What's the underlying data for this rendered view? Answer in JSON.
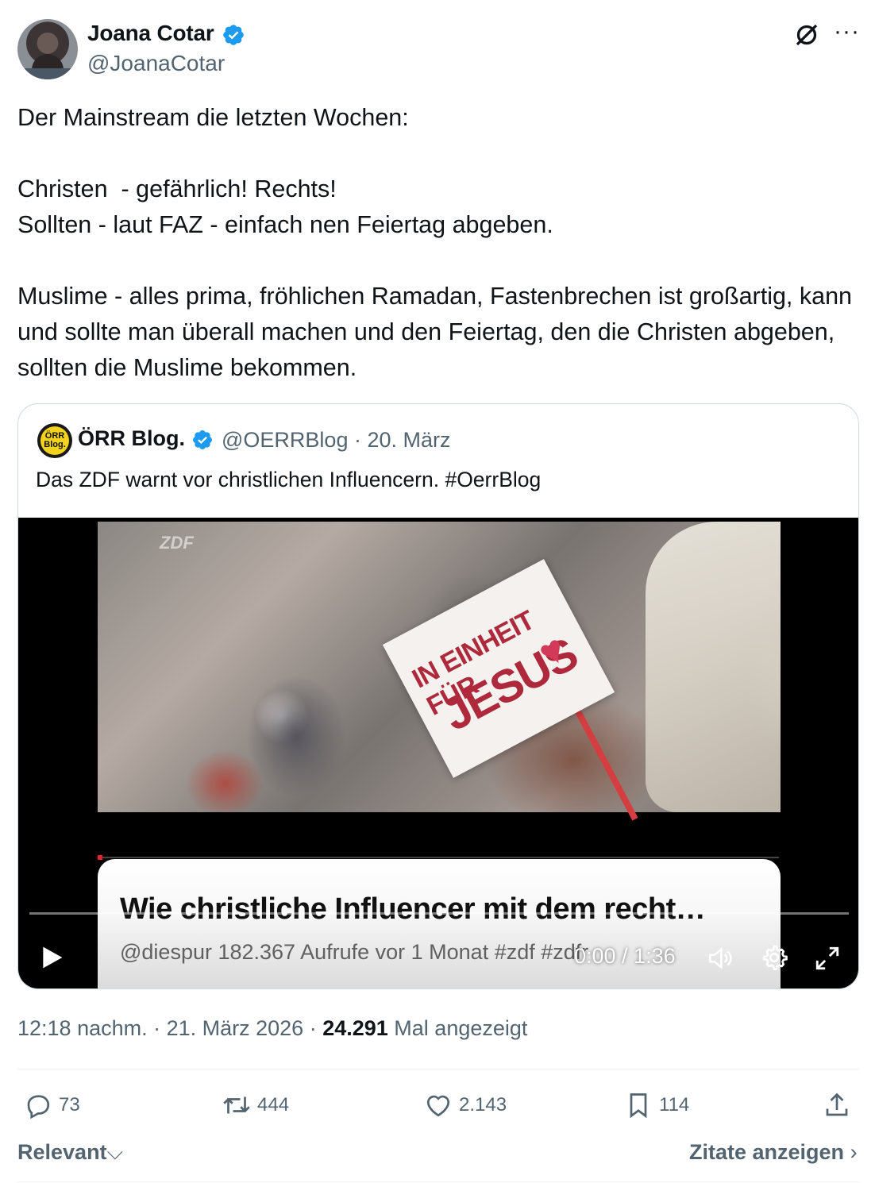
{
  "author": {
    "name": "Joana Cotar",
    "handle": "@JoanaCotar",
    "verified": true
  },
  "tweet": {
    "text": "Der Mainstream die letzten Wochen:\n\nChristen  - gefährlich! Rechts!\nSollten - laut FAZ - einfach nen Feiertag abgeben.\n\nMuslime - alles prima, fröhlichen Ramadan, Fastenbrechen ist großartig, kann und sollte man überall machen und den Feiertag, den die Christen abgeben, sollten die Muslime bekommen."
  },
  "quote": {
    "avatar_text": "ÖRR Blog.",
    "name": "ÖRR Blog.",
    "handle_date": "@OERRBlog · 20. März",
    "text": "Das ZDF warnt vor christlichen Influencern. #OerrBlog",
    "video": {
      "overlay_logo": "ZDF",
      "sign_line1": "IN EINHEIT FÜR",
      "sign_line2": "JESUS",
      "card_title": "Wie christliche Influencer mit dem recht…",
      "card_meta": "@diespur  182.367 Aufrufe  vor 1 Monat  #zdf  #zdfr",
      "time": "0:00 / 1:36",
      "progress": 0
    }
  },
  "meta": {
    "time_date": "12:18 nachm. · 21. März 2026 · ",
    "views": "24.291",
    "views_label": " Mal angezeigt"
  },
  "actions": {
    "replies": "73",
    "retweets": "444",
    "likes": "2.143",
    "bookmarks": "114"
  },
  "footer": {
    "sort_label": "Relevant",
    "quotes_label": "Zitate anzeigen"
  },
  "colors": {
    "verified": "#1d9bf0",
    "muted": "#536471",
    "text": "#0f1419"
  }
}
